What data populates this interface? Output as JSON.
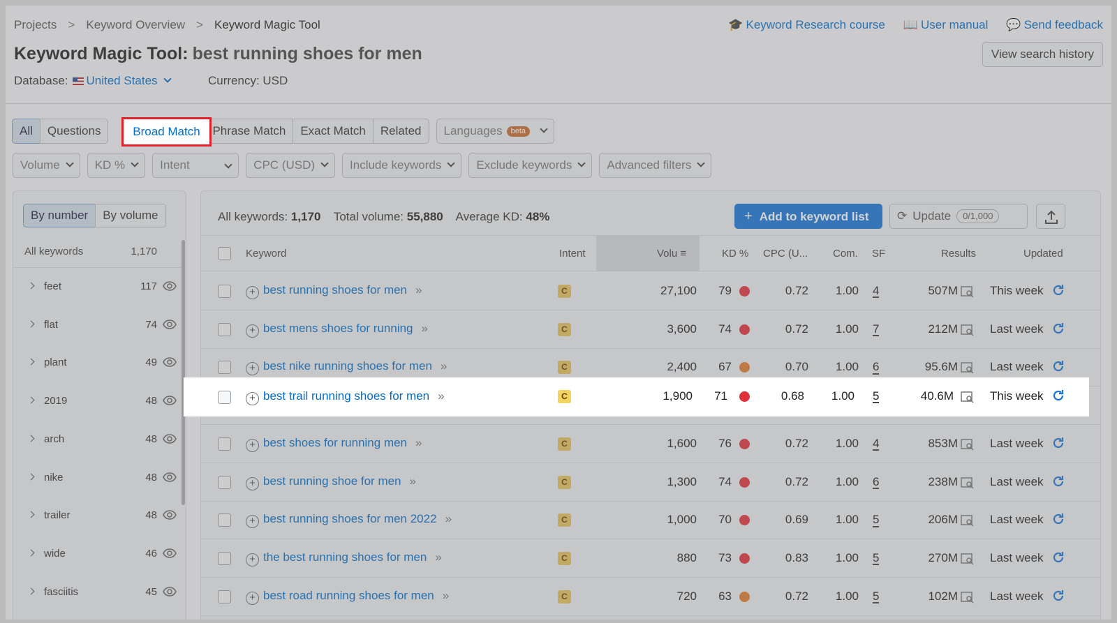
{
  "breadcrumb": [
    "Projects",
    "Keyword Overview",
    "Keyword Magic Tool"
  ],
  "header_links": [
    {
      "label": "Keyword Research course",
      "icon": "graduation-cap-icon"
    },
    {
      "label": "User manual",
      "icon": "book-icon"
    },
    {
      "label": "Send feedback",
      "icon": "chat-icon"
    }
  ],
  "title": {
    "tool": "Keyword Magic Tool:",
    "query": "best running shoes for men"
  },
  "view_history_label": "View search history",
  "database": {
    "label": "Database:",
    "value": "United States"
  },
  "currency": "Currency: USD",
  "match_tabs": {
    "all": "All",
    "questions": "Questions",
    "broad": "Broad Match",
    "phrase": "Phrase Match",
    "exact": "Exact Match",
    "related": "Related",
    "languages": "Languages",
    "beta": "beta"
  },
  "filters": [
    "Volume",
    "KD %",
    "Intent",
    "CPC (USD)",
    "Include keywords",
    "Exclude keywords",
    "Advanced filters"
  ],
  "sidebar": {
    "by_number": "By number",
    "by_volume": "By volume",
    "all_label": "All keywords",
    "all_count": "1,170",
    "groups": [
      {
        "label": "feet",
        "count": "117"
      },
      {
        "label": "flat",
        "count": "74"
      },
      {
        "label": "plant",
        "count": "49"
      },
      {
        "label": "2019",
        "count": "48"
      },
      {
        "label": "arch",
        "count": "48"
      },
      {
        "label": "nike",
        "count": "48"
      },
      {
        "label": "trailer",
        "count": "48"
      },
      {
        "label": "wide",
        "count": "46"
      },
      {
        "label": "fasciitis",
        "count": "45"
      }
    ]
  },
  "summary": {
    "all_label": "All keywords:",
    "all_value": "1,170",
    "vol_label": "Total volume:",
    "vol_value": "55,880",
    "kd_label": "Average KD:",
    "kd_value": "48%"
  },
  "actions": {
    "add": "Add to keyword list",
    "update": "Update",
    "quota": "0/1,000"
  },
  "columns": {
    "keyword": "Keyword",
    "intent": "Intent",
    "volume": "Volu",
    "kd": "KD %",
    "cpc": "CPC (U...",
    "com": "Com.",
    "sf": "SF",
    "results": "Results",
    "updated": "Updated"
  },
  "colors": {
    "kd_red": "#e0313a",
    "kd_orange": "#e07a2e",
    "link": "#006dca",
    "accent": "#1673d6"
  },
  "rows": [
    {
      "keyword": "best running shoes for men",
      "intent": "C",
      "volume": "27,100",
      "kd": "79",
      "kd_color": "#e0313a",
      "cpc": "0.72",
      "com": "1.00",
      "sf": "4",
      "results": "507M",
      "updated": "This week"
    },
    {
      "keyword": "best mens shoes for running",
      "intent": "C",
      "volume": "3,600",
      "kd": "74",
      "kd_color": "#e0313a",
      "cpc": "0.72",
      "com": "1.00",
      "sf": "7",
      "results": "212M",
      "updated": "Last week"
    },
    {
      "keyword": "best nike running shoes for men",
      "intent": "C",
      "volume": "2,400",
      "kd": "67",
      "kd_color": "#e07a2e",
      "cpc": "0.70",
      "com": "1.00",
      "sf": "6",
      "results": "95.6M",
      "updated": "Last week"
    },
    {
      "keyword": "best trail running shoes for men",
      "intent": "C",
      "volume": "1,900",
      "kd": "71",
      "kd_color": "#e0313a",
      "cpc": "0.68",
      "com": "1.00",
      "sf": "5",
      "results": "40.6M",
      "updated": "This week"
    },
    {
      "keyword": "best shoes for running men",
      "intent": "C",
      "volume": "1,600",
      "kd": "76",
      "kd_color": "#e0313a",
      "cpc": "0.72",
      "com": "1.00",
      "sf": "4",
      "results": "853M",
      "updated": "Last week"
    },
    {
      "keyword": "best running shoe for men",
      "intent": "C",
      "volume": "1,300",
      "kd": "74",
      "kd_color": "#e0313a",
      "cpc": "0.72",
      "com": "1.00",
      "sf": "6",
      "results": "238M",
      "updated": "Last week"
    },
    {
      "keyword": "best running shoes for men 2022",
      "intent": "C",
      "volume": "1,000",
      "kd": "70",
      "kd_color": "#e0313a",
      "cpc": "0.69",
      "com": "1.00",
      "sf": "5",
      "results": "206M",
      "updated": "Last week"
    },
    {
      "keyword": "the best running shoes for men",
      "intent": "C",
      "volume": "880",
      "kd": "73",
      "kd_color": "#e0313a",
      "cpc": "0.83",
      "com": "1.00",
      "sf": "5",
      "results": "270M",
      "updated": "Last week"
    },
    {
      "keyword": "best road running shoes for men",
      "intent": "C",
      "volume": "720",
      "kd": "63",
      "kd_color": "#e07a2e",
      "cpc": "0.72",
      "com": "1.00",
      "sf": "5",
      "results": "102M",
      "updated": "Last week"
    }
  ]
}
